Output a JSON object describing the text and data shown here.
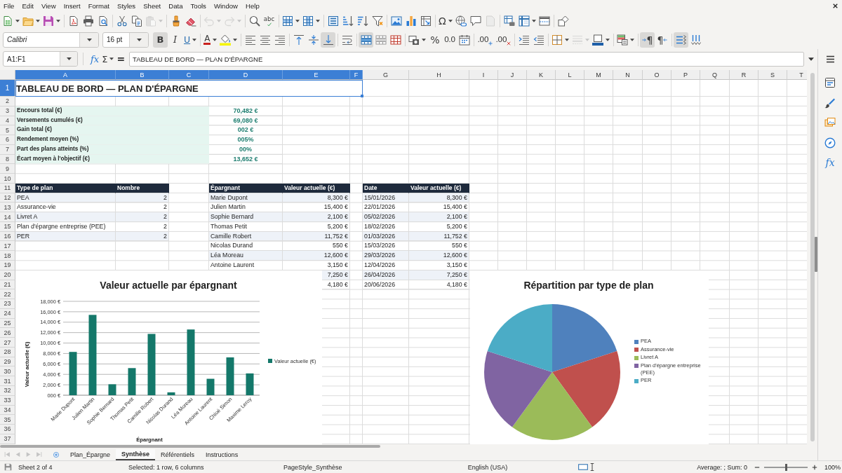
{
  "menu_bar": [
    "File",
    "Edit",
    "View",
    "Insert",
    "Format",
    "Styles",
    "Sheet",
    "Data",
    "Tools",
    "Window",
    "Help"
  ],
  "standard_toolbar": [
    [
      {
        "kind": "new",
        "dropdown": true,
        "disabled": false
      },
      {
        "kind": "open",
        "dropdown": true,
        "disabled": false
      },
      {
        "kind": "save",
        "dropdown": true,
        "disabled": false
      }
    ],
    [
      {
        "kind": "export_pdf",
        "dropdown": false,
        "disabled": false
      },
      {
        "kind": "print",
        "dropdown": false,
        "disabled": false
      },
      {
        "kind": "print_preview",
        "dropdown": false,
        "disabled": false
      }
    ],
    [
      {
        "kind": "cut",
        "dropdown": false,
        "disabled": false
      },
      {
        "kind": "copy",
        "dropdown": false,
        "disabled": false
      },
      {
        "kind": "paste",
        "dropdown": true,
        "disabled": true
      }
    ],
    [
      {
        "kind": "clone_formatting",
        "dropdown": false,
        "disabled": false
      },
      {
        "kind": "clear_formatting",
        "dropdown": false,
        "disabled": false
      }
    ],
    [
      {
        "kind": "undo",
        "dropdown": true,
        "disabled": true
      },
      {
        "kind": "redo",
        "dropdown": true,
        "disabled": true
      }
    ],
    [
      {
        "kind": "find_replace",
        "dropdown": false,
        "disabled": false
      },
      {
        "kind": "spelling",
        "glyph": "abc",
        "dropdown": false,
        "disabled": false
      }
    ],
    [
      {
        "kind": "row",
        "dropdown": true,
        "disabled": false
      },
      {
        "kind": "column",
        "dropdown": true,
        "disabled": false
      }
    ],
    [
      {
        "kind": "sort",
        "dropdown": false,
        "disabled": false
      },
      {
        "kind": "sort_ascending",
        "dropdown": false,
        "disabled": false
      },
      {
        "kind": "sort_descending",
        "dropdown": false,
        "disabled": false
      },
      {
        "kind": "autofilter",
        "dropdown": false,
        "disabled": false
      }
    ],
    [
      {
        "kind": "image",
        "dropdown": false,
        "disabled": false
      },
      {
        "kind": "chart",
        "dropdown": false,
        "disabled": false
      },
      {
        "kind": "pivot_table",
        "dropdown": false,
        "disabled": false
      }
    ],
    [
      {
        "kind": "special_character",
        "glyph": "Ω",
        "dropdown": true,
        "disabled": false
      },
      {
        "kind": "hyperlink",
        "dropdown": false,
        "disabled": false
      },
      {
        "kind": "comment",
        "dropdown": false,
        "disabled": false
      },
      {
        "kind": "header_footer",
        "dropdown": false,
        "disabled": true
      }
    ],
    [
      {
        "kind": "print_area",
        "dropdown": false,
        "disabled": false
      },
      {
        "kind": "freeze",
        "dropdown": true,
        "disabled": false
      },
      {
        "kind": "split_window",
        "dropdown": false,
        "disabled": false
      }
    ],
    [
      {
        "kind": "shapes",
        "dropdown": false,
        "disabled": false
      }
    ]
  ],
  "formatting_toolbar": {
    "font_name": "Calibri",
    "font_size": "16 pt",
    "groups": [
      [
        {
          "kind": "bold",
          "glyph": "B",
          "pressed": true,
          "dropdown": false,
          "disabled": false
        },
        {
          "kind": "italic",
          "glyph": "I",
          "pressed": false,
          "dropdown": false,
          "disabled": false
        },
        {
          "kind": "underline",
          "glyph": "U",
          "pressed": false,
          "dropdown": true,
          "disabled": false
        }
      ],
      [
        {
          "kind": "font_color",
          "glyph": "A",
          "pressed": false,
          "dropdown": true,
          "disabled": false
        },
        {
          "kind": "highlight",
          "pressed": false,
          "dropdown": true,
          "disabled": false
        }
      ],
      [
        {
          "kind": "align_left",
          "pressed": false,
          "dropdown": false,
          "disabled": false
        },
        {
          "kind": "align_center",
          "pressed": false,
          "dropdown": false,
          "disabled": false
        },
        {
          "kind": "align_right",
          "pressed": false,
          "dropdown": false,
          "disabled": false
        }
      ],
      [
        {
          "kind": "align_top",
          "pressed": false,
          "dropdown": false,
          "disabled": false
        },
        {
          "kind": "align_middle",
          "pressed": false,
          "dropdown": false,
          "disabled": false
        },
        {
          "kind": "align_bottom",
          "pressed": true,
          "dropdown": false,
          "disabled": false
        }
      ],
      [
        {
          "kind": "wrap_text",
          "pressed": false,
          "dropdown": false,
          "disabled": false
        }
      ],
      [
        {
          "kind": "merge_center",
          "pressed": true,
          "dropdown": false,
          "disabled": false
        },
        {
          "kind": "merge",
          "pressed": false,
          "dropdown": false,
          "disabled": false
        },
        {
          "kind": "unmerge",
          "pressed": false,
          "dropdown": false,
          "disabled": false
        }
      ],
      [
        {
          "kind": "number_format",
          "pressed": false,
          "dropdown": true,
          "disabled": false
        },
        {
          "kind": "percent",
          "glyph": "%",
          "pressed": false,
          "dropdown": false,
          "disabled": false
        },
        {
          "kind": "number",
          "glyph": "0.0",
          "pressed": false,
          "dropdown": false,
          "disabled": false
        },
        {
          "kind": "date",
          "pressed": false,
          "dropdown": false,
          "disabled": false
        }
      ],
      [
        {
          "kind": "add_decimal",
          "glyph": ".00",
          "pressed": false,
          "dropdown": false,
          "disabled": false
        },
        {
          "kind": "delete_decimal",
          "glyph": ".00",
          "pressed": false,
          "dropdown": false,
          "disabled": false
        }
      ],
      [
        {
          "kind": "indent",
          "pressed": false,
          "dropdown": false,
          "disabled": false
        },
        {
          "kind": "outdent",
          "pressed": false,
          "dropdown": false,
          "disabled": false
        }
      ],
      [
        {
          "kind": "borders",
          "pressed": false,
          "dropdown": true,
          "disabled": false
        },
        {
          "kind": "border_style",
          "pressed": false,
          "dropdown": true,
          "disabled": true
        },
        {
          "kind": "border_color",
          "pressed": false,
          "dropdown": true,
          "disabled": false
        }
      ],
      [
        {
          "kind": "conditional",
          "pressed": false,
          "dropdown": true,
          "disabled": false
        }
      ],
      [
        {
          "kind": "left_to_right",
          "glyph": "¶",
          "pressed": true,
          "dropdown": false,
          "disabled": false
        },
        {
          "kind": "right_to_left",
          "glyph": "¶",
          "pressed": false,
          "dropdown": false,
          "disabled": false
        }
      ],
      [
        {
          "kind": "text_horizontal",
          "pressed": true,
          "dropdown": false,
          "disabled": false
        },
        {
          "kind": "text_vertical",
          "pressed": false,
          "dropdown": false,
          "disabled": false
        }
      ]
    ]
  },
  "formula_bar": {
    "name_box": "A1:F1",
    "function_wizard": "fx",
    "sum": "Σ",
    "formula": "=",
    "content": "TABLEAU DE BORD — PLAN D'ÉPARGNE"
  },
  "sidebar": [
    {
      "kind": "properties"
    },
    {
      "kind": "styles"
    },
    {
      "kind": "gallery"
    },
    {
      "kind": "navigator"
    },
    {
      "kind": "functions",
      "glyph": "fx"
    }
  ],
  "column_headers": [
    {
      "label": "A",
      "selected": true
    },
    {
      "label": "B",
      "selected": true
    },
    {
      "label": "C",
      "selected": true
    },
    {
      "label": "D",
      "selected": true
    },
    {
      "label": "E",
      "selected": true
    },
    {
      "label": "F",
      "selected": true
    },
    {
      "label": "G",
      "selected": false
    },
    {
      "label": "H",
      "selected": false
    },
    {
      "label": "I",
      "selected": false
    },
    {
      "label": "J",
      "selected": false
    },
    {
      "label": "K",
      "selected": false
    },
    {
      "label": "L",
      "selected": false
    },
    {
      "label": "M",
      "selected": false
    },
    {
      "label": "N",
      "selected": false
    },
    {
      "label": "O",
      "selected": false
    },
    {
      "label": "P",
      "selected": false
    },
    {
      "label": "Q",
      "selected": false
    },
    {
      "label": "R",
      "selected": false
    },
    {
      "label": "S",
      "selected": false
    },
    {
      "label": "T",
      "selected": false
    }
  ],
  "row_headers": [
    {
      "label": "1",
      "selected": true
    },
    {
      "label": "2",
      "selected": false
    },
    {
      "label": "3",
      "selected": false
    },
    {
      "label": "4",
      "selected": false
    },
    {
      "label": "5",
      "selected": false
    },
    {
      "label": "6",
      "selected": false
    },
    {
      "label": "7",
      "selected": false
    },
    {
      "label": "8",
      "selected": false
    },
    {
      "label": "9",
      "selected": false
    },
    {
      "label": "10",
      "selected": false
    },
    {
      "label": "11",
      "selected": false
    },
    {
      "label": "12",
      "selected": false
    },
    {
      "label": "13",
      "selected": false
    },
    {
      "label": "14",
      "selected": false
    },
    {
      "label": "15",
      "selected": false
    },
    {
      "label": "16",
      "selected": false
    },
    {
      "label": "17",
      "selected": false
    },
    {
      "label": "18",
      "selected": false
    },
    {
      "label": "19",
      "selected": false
    },
    {
      "label": "20",
      "selected": false
    },
    {
      "label": "21",
      "selected": false
    },
    {
      "label": "22",
      "selected": false
    },
    {
      "label": "23",
      "selected": false
    },
    {
      "label": "24",
      "selected": false
    },
    {
      "label": "25",
      "selected": false
    },
    {
      "label": "26",
      "selected": false
    },
    {
      "label": "27",
      "selected": false
    },
    {
      "label": "28",
      "selected": false
    },
    {
      "label": "29",
      "selected": false
    },
    {
      "label": "30",
      "selected": false
    },
    {
      "label": "31",
      "selected": false
    },
    {
      "label": "32",
      "selected": false
    },
    {
      "label": "33",
      "selected": false
    },
    {
      "label": "34",
      "selected": false
    },
    {
      "label": "35",
      "selected": false
    },
    {
      "label": "36",
      "selected": false
    },
    {
      "label": "37",
      "selected": false
    }
  ],
  "sheet": {
    "title": {
      "text": "TABLEAU DE BORD — PLAN D'ÉPARGNE",
      "selected": true
    },
    "summary": [
      {
        "label": "Encours total (€)",
        "value": "70,482 €"
      },
      {
        "label": "Versements cumulés (€)",
        "value": "69,080 €"
      },
      {
        "label": "Gain total (€)",
        "value": "002 €"
      },
      {
        "label": "Rendement moyen (%)",
        "value": "005%"
      },
      {
        "label": "Part des plans atteints (%)",
        "value": "00%"
      },
      {
        "label": "Écart moyen à l'objectif (€)",
        "value": "13,652 €"
      }
    ],
    "plan_table": {
      "columns": [
        "Type de plan",
        "Nombre"
      ],
      "rows": [
        {
          "plan": "PEA",
          "count": "2"
        },
        {
          "plan": "Assurance-vie",
          "count": "2"
        },
        {
          "plan": "Livret A",
          "count": "2"
        },
        {
          "plan": "Plan d'épargne entreprise (PEE)",
          "count": "2"
        },
        {
          "plan": "PER",
          "count": "2"
        }
      ]
    },
    "saver_table": {
      "columns": [
        "Épargnant",
        "Valeur actuelle (€)"
      ],
      "rows": [
        {
          "name": "Marie Dupont",
          "value": "8,300 €"
        },
        {
          "name": "Julien Martin",
          "value": "15,400 €"
        },
        {
          "name": "Sophie Bernard",
          "value": "2,100 €"
        },
        {
          "name": "Thomas Petit",
          "value": "5,200 €"
        },
        {
          "name": "Camille Robert",
          "value": "11,752 €"
        },
        {
          "name": "Nicolas Durand",
          "value": "550 €"
        },
        {
          "name": "Léa Moreau",
          "value": "12,600 €"
        },
        {
          "name": "Antoine Laurent",
          "value": "3,150 €"
        },
        {
          "value": "7,250 €"
        },
        {
          "value": "4,180 €"
        }
      ]
    },
    "date_table": {
      "columns": [
        "Date",
        "Valeur actuelle (€)"
      ],
      "rows": [
        {
          "date": "15/01/2026",
          "value": "8,300 €"
        },
        {
          "date": "22/01/2026",
          "value": "15,400 €"
        },
        {
          "date": "05/02/2026",
          "value": "2,100 €"
        },
        {
          "date": "18/02/2026",
          "value": "5,200 €"
        },
        {
          "date": "01/03/2026",
          "value": "11,752 €"
        },
        {
          "date": "15/03/2026",
          "value": "550 €"
        },
        {
          "date": "29/03/2026",
          "value": "12,600 €"
        },
        {
          "date": "12/04/2026",
          "value": "3,150 €"
        },
        {
          "date": "26/04/2026",
          "value": "7,250 €"
        },
        {
          "date": "20/06/2026",
          "value": "4,180 €"
        }
      ]
    },
    "bar_chart": {
      "chart_data": {
        "type": "bar",
        "title": "Valeur actuelle par épargnant",
        "xlabel": "Épargnant",
        "ylabel": "Valeur actuelle (€)",
        "categories": [
          "Marie Dupont",
          "Julien Martin",
          "Sophie Bernard",
          "Thomas Petit",
          "Camille Robert",
          "Nicolas Durand",
          "Léa Moreau",
          "Antoine Laurent",
          "Chloé Simon",
          "Maxime Leroy"
        ],
        "series": [
          {
            "name": "Valeur actuelle (€)",
            "color": "#14786a",
            "values": [
              8300,
              15400,
              2100,
              5200,
              11752,
              550,
              12600,
              3150,
              7250,
              4180
            ]
          }
        ],
        "ylim": [
          0,
          18000
        ],
        "yticks": [
          {
            "value": 0,
            "label": "000 €"
          },
          {
            "value": 2000,
            "label": "2,000 €"
          },
          {
            "value": 4000,
            "label": "4,000 €"
          },
          {
            "value": 6000,
            "label": "6,000 €"
          },
          {
            "value": 8000,
            "label": "8,000 €"
          },
          {
            "value": 10000,
            "label": "10,000 €"
          },
          {
            "value": 12000,
            "label": "12,000 €"
          },
          {
            "value": 14000,
            "label": "14,000 €"
          },
          {
            "value": 16000,
            "label": "16,000 €"
          },
          {
            "value": 18000,
            "label": "18,000 €"
          }
        ],
        "grid": true,
        "legend": true
      }
    },
    "pie_chart": {
      "chart_data": {
        "type": "pie",
        "title": "Répartition par type de plan",
        "categories": [
          "PEA",
          "Assurance-vie",
          "Livret A",
          "Plan d'épargne entreprise (PEE)",
          "PER"
        ],
        "series": [
          {
            "values": [
              20,
              20,
              20,
              20,
              20
            ]
          }
        ],
        "colors": [
          "#4f81bd",
          "#c0504d",
          "#9bbb59",
          "#8064a2",
          "#4bacc6"
        ],
        "legend": true
      }
    }
  },
  "sheet_tabs": {
    "navigation": [
      {
        "kind": "first",
        "disabled": true
      },
      {
        "kind": "previous",
        "disabled": true
      },
      {
        "kind": "next",
        "disabled": true
      },
      {
        "kind": "last",
        "disabled": true
      }
    ],
    "tabs": [
      {
        "label": "Plan_Épargne",
        "selected": false
      },
      {
        "label": "Synthèse",
        "selected": true
      },
      {
        "label": "Référentiels",
        "selected": false
      },
      {
        "label": "Instructions",
        "selected": false
      }
    ]
  },
  "status_bar": {
    "sheet_position": "Sheet 2 of 4",
    "selection": "Selected: 1 row, 6 columns",
    "page_style": "PageStyle_Synthèse",
    "language": "English (USA)",
    "summary": "Average: ; Sum: 0",
    "zoom": {
      "level": 0.5,
      "label": "100%"
    }
  }
}
